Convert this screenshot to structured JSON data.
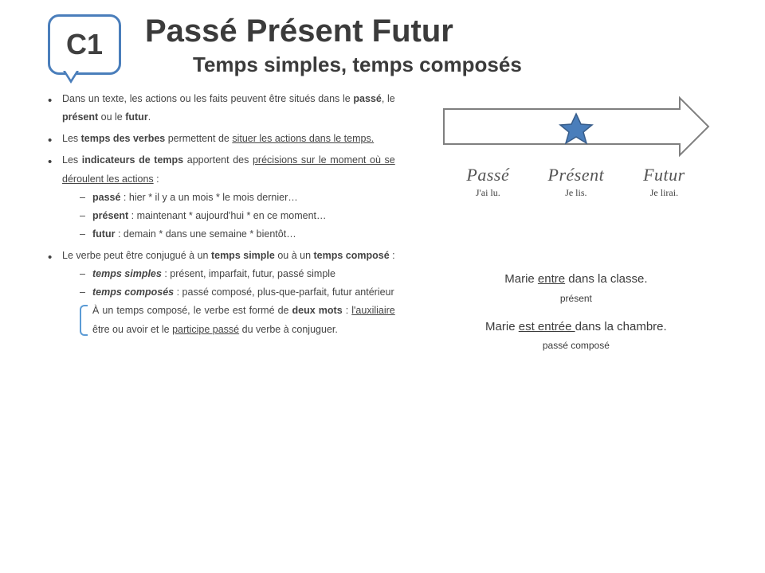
{
  "badge": "C1",
  "title": "Passé Présent Futur",
  "subtitle": "Temps simples, temps composés",
  "bullets": {
    "b1_pre": "Dans un texte, les actions ou les faits peuvent être situés dans le ",
    "b1_bold1": "passé",
    "b1_mid1": ", le ",
    "b1_bold2": "présent",
    "b1_mid2": " ou le ",
    "b1_bold3": "futur",
    "b1_end": ".",
    "b2_pre": "Les ",
    "b2_bold": "temps des verbes",
    "b2_mid": " permettent de ",
    "b2_u": "situer les actions dans le temps.",
    "b3_pre": "Les ",
    "b3_bold": "indicateurs de temps",
    "b3_mid": " apportent des ",
    "b3_u": "précisions sur le moment où se déroulent les actions",
    "b3_end": " :",
    "b3a_bold": "passé",
    "b3a_txt": " : hier * il y a un mois * le mois dernier…",
    "b3b_bold": "présent",
    "b3b_txt": " : maintenant * aujourd'hui * en ce moment…",
    "b3c_bold": "futur",
    "b3c_txt": " : demain * dans une semaine * bientôt…",
    "b4_pre": "Le verbe peut être conjugué à un ",
    "b4_bold1": "temps simple",
    "b4_mid": " ou à un ",
    "b4_bold2": "temps composé",
    "b4_end": " :",
    "b4a_bold": "temps simples",
    "b4a_txt": " : présent, imparfait, futur, passé simple",
    "b4b_bold": "temps composés",
    "b4b_txt": " : passé composé, plus-que-parfait, futur antérieur",
    "note_pre": "À un temps composé, le verbe est formé de ",
    "note_bold": "deux mots",
    "note_mid": " : ",
    "note_u1": "l'auxiliaire",
    "note_mid2": " être ou avoir et le ",
    "note_u2": "participe passé",
    "note_end": " du verbe à conjuguer."
  },
  "timeline": {
    "cols": [
      {
        "head": "Passé",
        "sub": "J'ai lu."
      },
      {
        "head": "Présent",
        "sub": "Je lis."
      },
      {
        "head": "Futur",
        "sub": "Je lirai."
      }
    ]
  },
  "examples": {
    "line1_a": "Marie ",
    "line1_u": "entre",
    "line1_b": " dans la classe.",
    "tag1": "présent",
    "line2_a": "Marie ",
    "line2_u": "est entrée ",
    "line2_b": "dans la chambre.",
    "tag2": "passé composé"
  }
}
